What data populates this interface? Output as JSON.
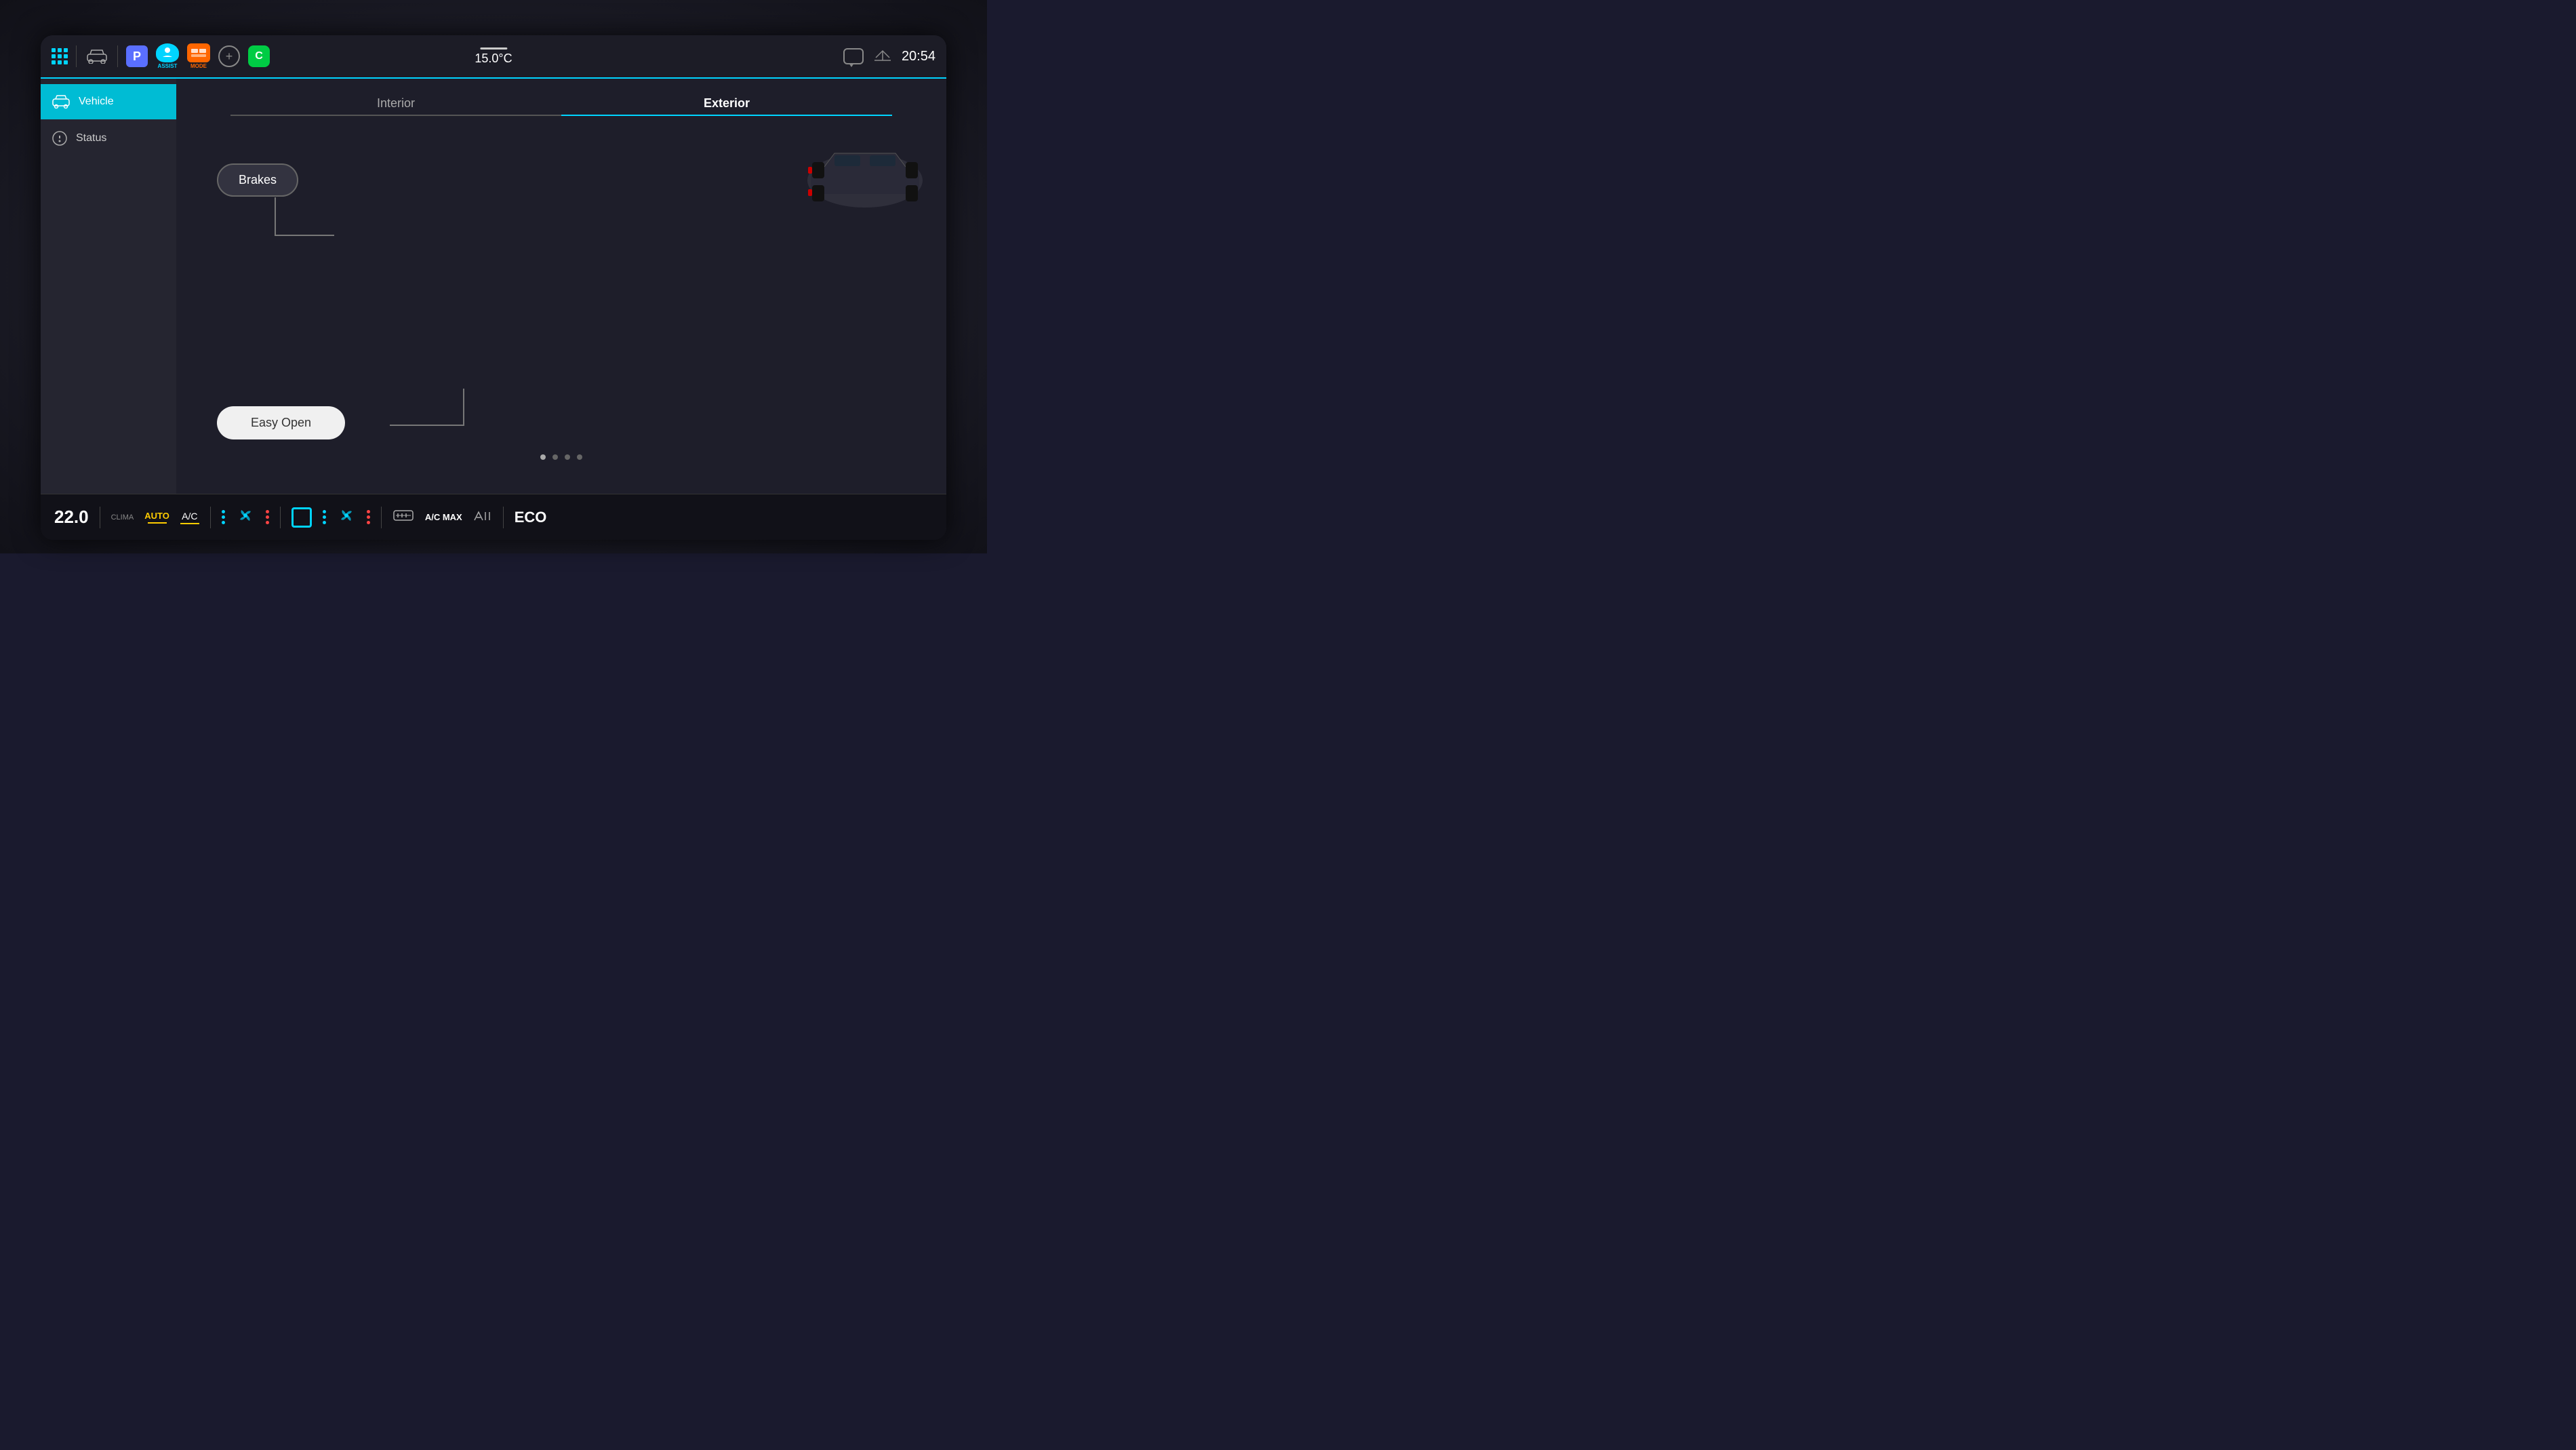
{
  "screen": {
    "background_color": "#1c1c26",
    "accent_color": "#00d4ff"
  },
  "top_bar": {
    "temperature": "15.0°C",
    "time": "20:54",
    "assist_label": "ASSIST",
    "mode_label": "MODE",
    "parking_label": "P",
    "c_button_label": "C",
    "plus_button_label": "+"
  },
  "sidebar": {
    "items": [
      {
        "id": "vehicle",
        "label": "Vehicle",
        "active": true
      },
      {
        "id": "status",
        "label": "Status",
        "active": false
      }
    ]
  },
  "tabs": [
    {
      "id": "interior",
      "label": "Interior",
      "active": false
    },
    {
      "id": "exterior",
      "label": "Exterior",
      "active": true
    }
  ],
  "content": {
    "brakes_button": "Brakes",
    "easy_open_button": "Easy Open",
    "pagination_dots": 4,
    "active_dot": 0
  },
  "bottom_bar": {
    "temperature": "22.0",
    "clima_label": "CLIMA",
    "auto_label": "AUTO",
    "ac_label": "A/C",
    "eco_label": "ECO",
    "ac_max_label": "A/C MAX"
  }
}
